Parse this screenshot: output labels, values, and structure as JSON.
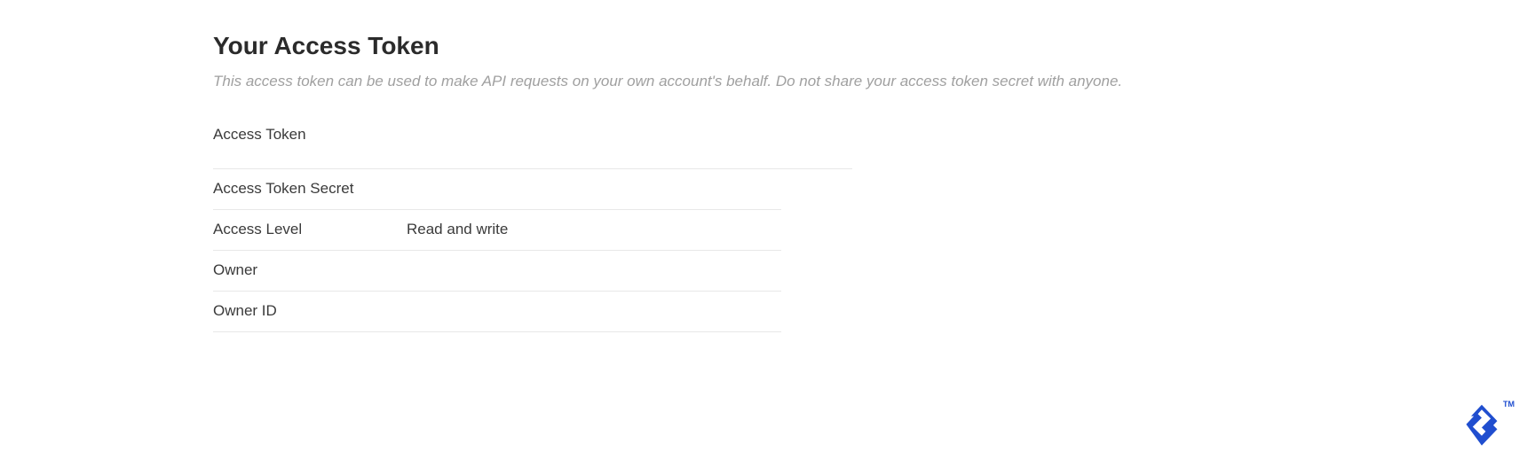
{
  "header": {
    "title": "Your Access Token",
    "subtitle": "This access token can be used to make API requests on your own account's behalf. Do not share your access token secret with anyone."
  },
  "fields": {
    "access_token": {
      "label": "Access Token",
      "value": ""
    },
    "access_token_secret": {
      "label": "Access Token Secret",
      "value": ""
    },
    "access_level": {
      "label": "Access Level",
      "value": "Read and write"
    },
    "owner": {
      "label": "Owner",
      "value": ""
    },
    "owner_id": {
      "label": "Owner ID",
      "value": ""
    }
  },
  "branding": {
    "trademark": "TM"
  }
}
